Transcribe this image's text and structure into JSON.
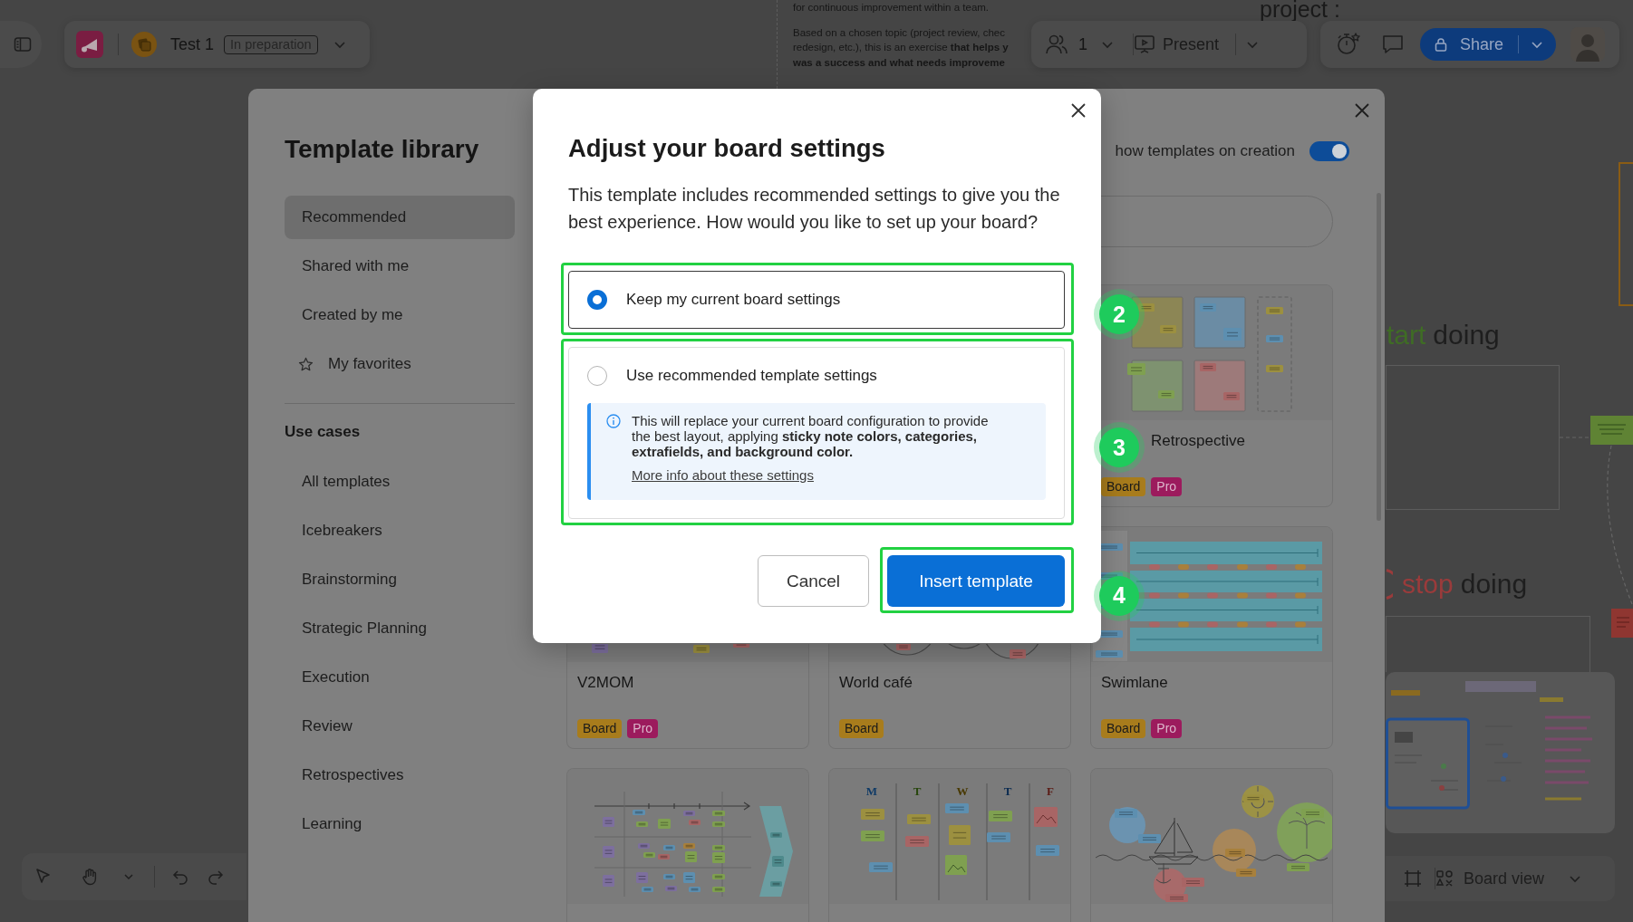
{
  "top_bar": {
    "board_name": "Test 1",
    "status": "In preparation",
    "participants": "1",
    "present_label": "Present",
    "share_label": "Share"
  },
  "board": {
    "note_lines": [
      "for continuous improvement within a team.",
      "Based on a chosen topic (project review, chec",
      "redesign, etc.), this is an exercise **that helps y**",
      "**was a success and what needs improveme**"
    ],
    "title_fragment": "project :",
    "headings": [
      {
        "kind": "plain",
        "accent": "tart",
        "text": "doing",
        "color": "#3f6c25"
      },
      {
        "kind": "circled",
        "accent": "stop",
        "text": "doing",
        "color": "#9a3b3b"
      }
    ],
    "view_menu": "Board view"
  },
  "template_library": {
    "title": "Template library",
    "nav": [
      {
        "label": "Recommended",
        "kind": "link",
        "selected": true
      },
      {
        "label": "Shared with me",
        "kind": "link",
        "selected": false
      },
      {
        "label": "Created by me",
        "kind": "link",
        "selected": false
      },
      {
        "label": "My favorites",
        "kind": "favorites",
        "selected": false
      }
    ],
    "use_cases_heading": "Use cases",
    "use_cases": [
      {
        "label": "All templates",
        "selected": false
      },
      {
        "label": "Icebreakers",
        "selected": false
      },
      {
        "label": "Brainstorming",
        "selected": false
      },
      {
        "label": "Strategic Planning",
        "selected": false
      },
      {
        "label": "Execution",
        "selected": false
      },
      {
        "label": "Review",
        "selected": false
      },
      {
        "label": "Retrospectives",
        "selected": false
      },
      {
        "label": "Learning",
        "selected": false
      }
    ],
    "show_on_creation": {
      "label": "how templates on creation",
      "on": true
    },
    "templates": [
      {
        "kind": "quadrants",
        "title": "Retrospective",
        "tags": [
          {
            "label": "Board",
            "color": "#a87c1c"
          },
          {
            "label": "Pro",
            "color": "#9c1b5d"
          }
        ]
      },
      {
        "kind": "notes",
        "title": "V2MOM",
        "tags": [
          {
            "label": "Board",
            "color": "#a87c1c"
          },
          {
            "label": "Pro",
            "color": "#9c1b5d"
          }
        ]
      },
      {
        "kind": "circles",
        "title": "World café",
        "tags": [
          {
            "label": "Board",
            "color": "#a87c1c"
          }
        ]
      },
      {
        "kind": "lanes",
        "title": "Swimlane",
        "tags": [
          {
            "label": "Board",
            "color": "#a87c1c"
          },
          {
            "label": "Pro",
            "color": "#9c1b5d"
          }
        ]
      },
      {
        "kind": "timeline"
      },
      {
        "kind": "week",
        "day_labels": [
          {
            "text": "M",
            "color": "#0f3a66"
          },
          {
            "text": "T",
            "color": "#27460c"
          },
          {
            "text": "W",
            "color": "#483800"
          },
          {
            "text": "T",
            "color": "#0a2a50"
          },
          {
            "text": "F",
            "color": "#5a1a14"
          }
        ]
      },
      {
        "kind": "sailboat"
      }
    ]
  },
  "dialog": {
    "title": "Adjust your board settings",
    "description": "This template includes recommended settings to give you the best experience. How would you like to set up your board?",
    "options": [
      {
        "label": "Keep my current board settings",
        "selected": true,
        "callout": "2"
      },
      {
        "label": "Use recommended template settings",
        "selected": false,
        "callout": "3",
        "info": {
          "text": "This will replace your current board configuration to provide the best layout, applying **sticky note colors, categories, extrafields, and background color.**",
          "link": "More info about these settings"
        }
      }
    ],
    "buttons": [
      {
        "label": "Cancel",
        "kind": "secondary"
      },
      {
        "label": "Insert template",
        "kind": "primary",
        "callout": "4"
      }
    ]
  }
}
